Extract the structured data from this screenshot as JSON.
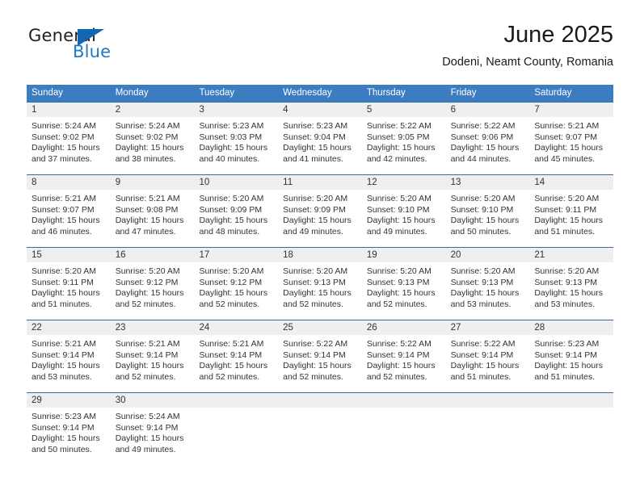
{
  "logo": {
    "primary_text": "General",
    "secondary_text": "Blue",
    "primary_color": "#231f20",
    "secondary_color": "#1f7ac4",
    "triangle_color": "#1168b0",
    "triangle_icon": "triangle-icon"
  },
  "header": {
    "title": "June 2025",
    "subtitle": "Dodeni, Neamt County, Romania"
  },
  "theme": {
    "header_bar_color": "#3b7dc0",
    "day_number_band_color": "#efefef",
    "week_divider_color": "#2f6cab",
    "text_color": "#333333"
  },
  "calendar": {
    "day_headers": [
      "Sunday",
      "Monday",
      "Tuesday",
      "Wednesday",
      "Thursday",
      "Friday",
      "Saturday"
    ],
    "weeks": [
      {
        "days": [
          {
            "number": "1",
            "sunrise": "Sunrise: 5:24 AM",
            "sunset": "Sunset: 9:02 PM",
            "daylight": "Daylight: 15 hours and 37 minutes."
          },
          {
            "number": "2",
            "sunrise": "Sunrise: 5:24 AM",
            "sunset": "Sunset: 9:02 PM",
            "daylight": "Daylight: 15 hours and 38 minutes."
          },
          {
            "number": "3",
            "sunrise": "Sunrise: 5:23 AM",
            "sunset": "Sunset: 9:03 PM",
            "daylight": "Daylight: 15 hours and 40 minutes."
          },
          {
            "number": "4",
            "sunrise": "Sunrise: 5:23 AM",
            "sunset": "Sunset: 9:04 PM",
            "daylight": "Daylight: 15 hours and 41 minutes."
          },
          {
            "number": "5",
            "sunrise": "Sunrise: 5:22 AM",
            "sunset": "Sunset: 9:05 PM",
            "daylight": "Daylight: 15 hours and 42 minutes."
          },
          {
            "number": "6",
            "sunrise": "Sunrise: 5:22 AM",
            "sunset": "Sunset: 9:06 PM",
            "daylight": "Daylight: 15 hours and 44 minutes."
          },
          {
            "number": "7",
            "sunrise": "Sunrise: 5:21 AM",
            "sunset": "Sunset: 9:07 PM",
            "daylight": "Daylight: 15 hours and 45 minutes."
          }
        ]
      },
      {
        "days": [
          {
            "number": "8",
            "sunrise": "Sunrise: 5:21 AM",
            "sunset": "Sunset: 9:07 PM",
            "daylight": "Daylight: 15 hours and 46 minutes."
          },
          {
            "number": "9",
            "sunrise": "Sunrise: 5:21 AM",
            "sunset": "Sunset: 9:08 PM",
            "daylight": "Daylight: 15 hours and 47 minutes."
          },
          {
            "number": "10",
            "sunrise": "Sunrise: 5:20 AM",
            "sunset": "Sunset: 9:09 PM",
            "daylight": "Daylight: 15 hours and 48 minutes."
          },
          {
            "number": "11",
            "sunrise": "Sunrise: 5:20 AM",
            "sunset": "Sunset: 9:09 PM",
            "daylight": "Daylight: 15 hours and 49 minutes."
          },
          {
            "number": "12",
            "sunrise": "Sunrise: 5:20 AM",
            "sunset": "Sunset: 9:10 PM",
            "daylight": "Daylight: 15 hours and 49 minutes."
          },
          {
            "number": "13",
            "sunrise": "Sunrise: 5:20 AM",
            "sunset": "Sunset: 9:10 PM",
            "daylight": "Daylight: 15 hours and 50 minutes."
          },
          {
            "number": "14",
            "sunrise": "Sunrise: 5:20 AM",
            "sunset": "Sunset: 9:11 PM",
            "daylight": "Daylight: 15 hours and 51 minutes."
          }
        ]
      },
      {
        "days": [
          {
            "number": "15",
            "sunrise": "Sunrise: 5:20 AM",
            "sunset": "Sunset: 9:11 PM",
            "daylight": "Daylight: 15 hours and 51 minutes."
          },
          {
            "number": "16",
            "sunrise": "Sunrise: 5:20 AM",
            "sunset": "Sunset: 9:12 PM",
            "daylight": "Daylight: 15 hours and 52 minutes."
          },
          {
            "number": "17",
            "sunrise": "Sunrise: 5:20 AM",
            "sunset": "Sunset: 9:12 PM",
            "daylight": "Daylight: 15 hours and 52 minutes."
          },
          {
            "number": "18",
            "sunrise": "Sunrise: 5:20 AM",
            "sunset": "Sunset: 9:13 PM",
            "daylight": "Daylight: 15 hours and 52 minutes."
          },
          {
            "number": "19",
            "sunrise": "Sunrise: 5:20 AM",
            "sunset": "Sunset: 9:13 PM",
            "daylight": "Daylight: 15 hours and 52 minutes."
          },
          {
            "number": "20",
            "sunrise": "Sunrise: 5:20 AM",
            "sunset": "Sunset: 9:13 PM",
            "daylight": "Daylight: 15 hours and 53 minutes."
          },
          {
            "number": "21",
            "sunrise": "Sunrise: 5:20 AM",
            "sunset": "Sunset: 9:13 PM",
            "daylight": "Daylight: 15 hours and 53 minutes."
          }
        ]
      },
      {
        "days": [
          {
            "number": "22",
            "sunrise": "Sunrise: 5:21 AM",
            "sunset": "Sunset: 9:14 PM",
            "daylight": "Daylight: 15 hours and 53 minutes."
          },
          {
            "number": "23",
            "sunrise": "Sunrise: 5:21 AM",
            "sunset": "Sunset: 9:14 PM",
            "daylight": "Daylight: 15 hours and 52 minutes."
          },
          {
            "number": "24",
            "sunrise": "Sunrise: 5:21 AM",
            "sunset": "Sunset: 9:14 PM",
            "daylight": "Daylight: 15 hours and 52 minutes."
          },
          {
            "number": "25",
            "sunrise": "Sunrise: 5:22 AM",
            "sunset": "Sunset: 9:14 PM",
            "daylight": "Daylight: 15 hours and 52 minutes."
          },
          {
            "number": "26",
            "sunrise": "Sunrise: 5:22 AM",
            "sunset": "Sunset: 9:14 PM",
            "daylight": "Daylight: 15 hours and 52 minutes."
          },
          {
            "number": "27",
            "sunrise": "Sunrise: 5:22 AM",
            "sunset": "Sunset: 9:14 PM",
            "daylight": "Daylight: 15 hours and 51 minutes."
          },
          {
            "number": "28",
            "sunrise": "Sunrise: 5:23 AM",
            "sunset": "Sunset: 9:14 PM",
            "daylight": "Daylight: 15 hours and 51 minutes."
          }
        ]
      },
      {
        "days": [
          {
            "number": "29",
            "sunrise": "Sunrise: 5:23 AM",
            "sunset": "Sunset: 9:14 PM",
            "daylight": "Daylight: 15 hours and 50 minutes."
          },
          {
            "number": "30",
            "sunrise": "Sunrise: 5:24 AM",
            "sunset": "Sunset: 9:14 PM",
            "daylight": "Daylight: 15 hours and 49 minutes."
          },
          {
            "number": "",
            "sunrise": "",
            "sunset": "",
            "daylight": ""
          },
          {
            "number": "",
            "sunrise": "",
            "sunset": "",
            "daylight": ""
          },
          {
            "number": "",
            "sunrise": "",
            "sunset": "",
            "daylight": ""
          },
          {
            "number": "",
            "sunrise": "",
            "sunset": "",
            "daylight": ""
          },
          {
            "number": "",
            "sunrise": "",
            "sunset": "",
            "daylight": ""
          }
        ]
      }
    ]
  }
}
